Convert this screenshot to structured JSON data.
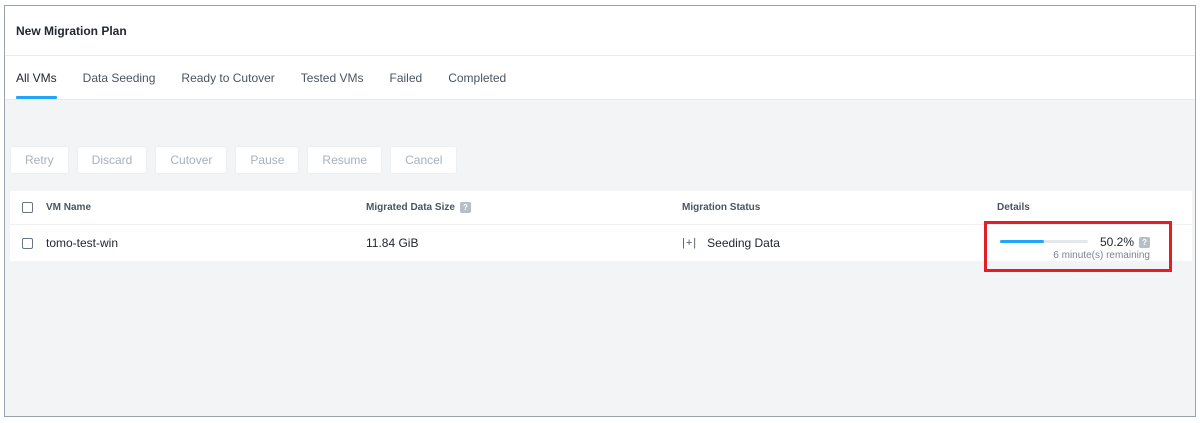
{
  "header": {
    "title": "New Migration Plan"
  },
  "tabs": [
    {
      "label": "All VMs",
      "active": true
    },
    {
      "label": "Data Seeding",
      "active": false
    },
    {
      "label": "Ready to Cutover",
      "active": false
    },
    {
      "label": "Tested VMs",
      "active": false
    },
    {
      "label": "Failed",
      "active": false
    },
    {
      "label": "Completed",
      "active": false
    }
  ],
  "toolbar": {
    "retry": "Retry",
    "discard": "Discard",
    "cutover": "Cutover",
    "pause": "Pause",
    "resume": "Resume",
    "cancel": "Cancel"
  },
  "table": {
    "headers": {
      "vm_name": "VM Name",
      "migrated_size": "Migrated Data Size",
      "status": "Migration Status",
      "details": "Details"
    },
    "rows": [
      {
        "vm_name": "tomo-test-win",
        "migrated_size": "11.84 GiB",
        "status": "Seeding Data",
        "progress_percent": 50.2,
        "progress_text": "50.2%",
        "remaining": "6 minute(s) remaining"
      }
    ]
  },
  "icons": {
    "help": "help-icon",
    "seeding": "seeding-status-icon",
    "help_glyph": "?",
    "seeding_glyph": "|+|"
  },
  "colors": {
    "accent": "#22a5f7",
    "highlight_border": "#e21f26"
  }
}
